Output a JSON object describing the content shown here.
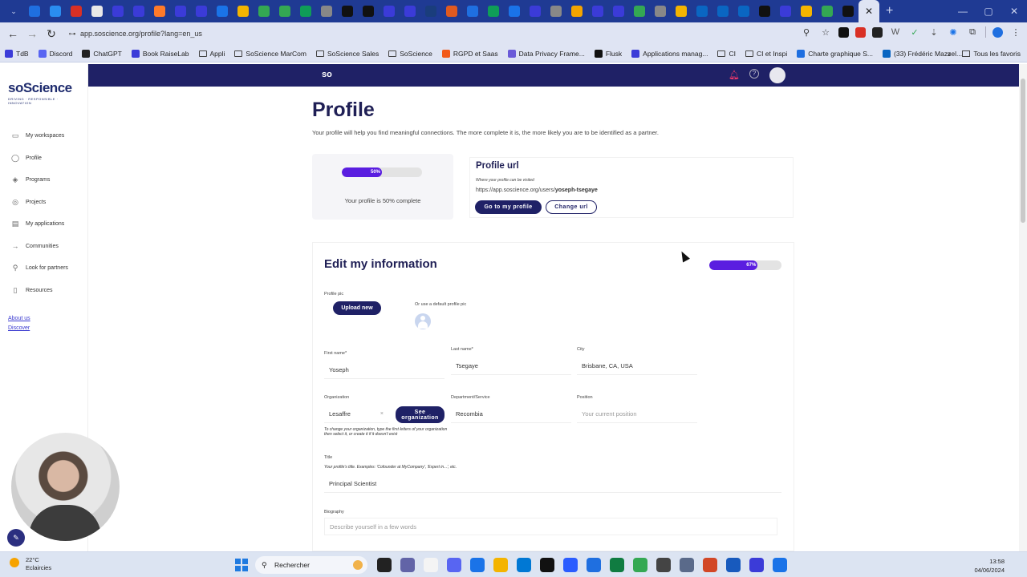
{
  "browser": {
    "url": "app.soscience.org/profile?lang=en_us",
    "tab_colors": [
      "#1f6fe0",
      "#2a8df0",
      "#d93025",
      "#e8e8e8",
      "#3b3bd8",
      "#3b3bd8",
      "#ff7a2a",
      "#3b3bd8",
      "#3b3bd8",
      "#1a73e8",
      "#f4b400",
      "#34a853",
      "#34a853",
      "#0f9d58",
      "#888888",
      "#111111",
      "#111111",
      "#3b3bd8",
      "#3b3bd8",
      "#1a3d7c",
      "#e05a20",
      "#1f6fe0",
      "#0f9d58",
      "#1a73e8",
      "#3b3bd8",
      "#888888",
      "#f4a400",
      "#3b3bd8",
      "#3b3bd8",
      "#34a853",
      "#888888",
      "#f4b400",
      "#0a66c2",
      "#0a66c2",
      "#0a66c2",
      "#111111",
      "#3b3bd8",
      "#f4b400",
      "#34a853",
      "#111111",
      "#dfe4f3"
    ],
    "bookmarks": [
      {
        "label": "TdB",
        "color": "#3b3bd8"
      },
      {
        "label": "Discord",
        "color": "#5865f2"
      },
      {
        "label": "ChatGPT",
        "color": "#222222"
      },
      {
        "label": "Book RaiseLab",
        "color": "#3b3bd8"
      },
      {
        "label": "Appli",
        "folder": true
      },
      {
        "label": "SoScience MarCom",
        "folder": true
      },
      {
        "label": "SoScience Sales",
        "folder": true
      },
      {
        "label": "SoScience",
        "folder": true
      },
      {
        "label": "RGPD et Saas",
        "color": "#f25a1a"
      },
      {
        "label": "Data Privacy Frame...",
        "color": "#6a5ad8"
      },
      {
        "label": "Flusk",
        "color": "#111111"
      },
      {
        "label": "Applications manag...",
        "color": "#3b3bd8"
      },
      {
        "label": "CI",
        "folder": true
      },
      {
        "label": "CI et Inspi",
        "folder": true
      },
      {
        "label": "Charte graphique S...",
        "color": "#1f6fe0"
      },
      {
        "label": "(33) Frédéric Mazzel...",
        "color": "#0a66c2"
      }
    ],
    "bookmarks_more": "»",
    "all_bookmarks": "Tous les favoris"
  },
  "app": {
    "logo_word": "soScience",
    "logo_tag": "DRIVING · RESPONSIBLE · INNOVATION",
    "sidebar": [
      {
        "label": "My workspaces",
        "icon": "briefcase-icon",
        "glyph": "▭"
      },
      {
        "label": "Profile",
        "icon": "user-icon",
        "glyph": "◯"
      },
      {
        "label": "Programs",
        "icon": "stack-icon",
        "glyph": "◈"
      },
      {
        "label": "Projects",
        "icon": "target-icon",
        "glyph": "◎"
      },
      {
        "label": "My applications",
        "icon": "document-icon",
        "glyph": "▤"
      },
      {
        "label": "Communities",
        "icon": "arrow-right-icon",
        "glyph": "→"
      },
      {
        "label": "Look for partners",
        "icon": "search-icon",
        "glyph": "⚲"
      },
      {
        "label": "Resources",
        "icon": "bookmark-icon",
        "glyph": "▯"
      }
    ],
    "footer_links": [
      "About us",
      "Discover"
    ],
    "topbar_logo": "so"
  },
  "profile": {
    "title": "Profile",
    "subtitle": "Your profile will help you find meaningful connections. The more complete it is, the more likely you are to be identified as a partner.",
    "completion_label": "50%",
    "completion_value": 0.5,
    "completion_text": "Your profile is 50% complete",
    "url_card": {
      "title": "Profile url",
      "hint": "Where your profile can be visited",
      "url_prefix": "https://app.soscience.org/users/",
      "url_slug": "yoseph-tsegaye",
      "go_button": "Go to my profile",
      "change_button": "Change url"
    }
  },
  "edit": {
    "title": "Edit my information",
    "progress_label": "67%",
    "progress_value": 0.67,
    "profile_pic_label": "Profile pic",
    "upload_button": "Upload new",
    "default_pic_label": "Or use a default profile pic",
    "first_name_label": "First name*",
    "first_name_value": "Yoseph",
    "last_name_label": "Last name*",
    "last_name_value": "Tsegaye",
    "city_label": "City",
    "city_value": "Brisbane, CA, USA",
    "organization_label": "Organization",
    "organization_value": "Lesaffre",
    "organization_clear": "×",
    "see_org_button": "See organization",
    "org_hint": "To change your organization, type the first letters of your organization then select it, or create it if it doesn't exist",
    "department_label": "Department/Service",
    "department_value": "Recombia",
    "position_label": "Position",
    "position_placeholder": "Your current position",
    "title_label": "Title",
    "title_hint": "Your profile's title. Examples: 'Cofounder at MyCompany', 'Expert in...', etc.",
    "title_value": "Principal Scientist",
    "bio_label": "Biography",
    "bio_placeholder": "Describe yourself in a few words"
  },
  "taskbar": {
    "temp": "22°C",
    "weather": "Eclaircies",
    "search_label": "Rechercher",
    "time": "13:58",
    "date": "04/06/2024",
    "app_colors": [
      "#222222",
      "#6264a7",
      "#f4f4f4",
      "#5865f2",
      "#1a73e8",
      "#f4b400",
      "#0078d4",
      "#111111",
      "#2a5cff",
      "#1f6fe0",
      "#107c41",
      "#34a853",
      "#444444",
      "#5a6a8a",
      "#d24726",
      "#185abd",
      "#3b3bd8",
      "#1a73e8"
    ]
  }
}
